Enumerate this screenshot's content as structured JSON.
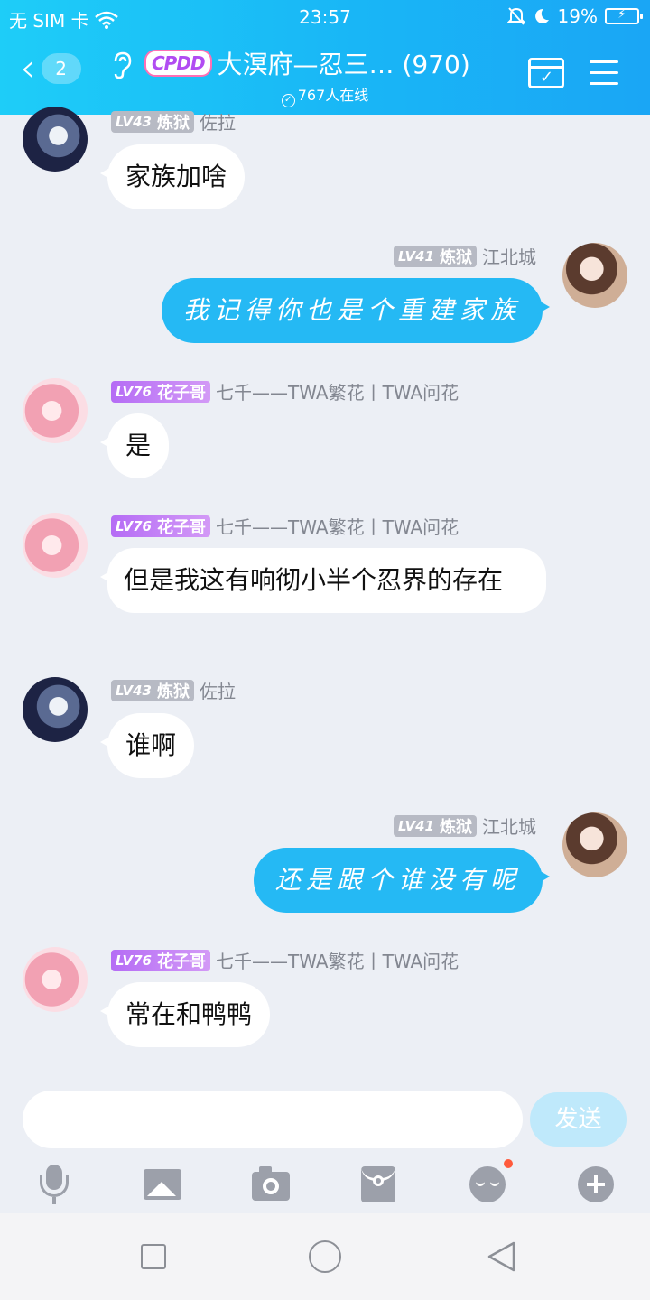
{
  "status_bar": {
    "carrier": "无 SIM 卡",
    "time": "23:57",
    "battery": "19%"
  },
  "header": {
    "back_count": "2",
    "group_badge": "CPDD",
    "title": "大溟府—忍三… (970)",
    "online": "767人在线"
  },
  "messages": [
    {
      "dir": "in",
      "level": "LV43",
      "tag": "炼狱",
      "sender": "佐拉",
      "text": "家族加啥"
    },
    {
      "dir": "out",
      "level": "LV41",
      "tag": "炼狱",
      "sender": "江北城",
      "text": "我记得你也是个重建家族"
    },
    {
      "dir": "in",
      "level": "LV76",
      "tag": "花子哥",
      "sender": "七千——TWA繁花丨TWA问花",
      "text": "是"
    },
    {
      "dir": "in",
      "level": "LV76",
      "tag": "花子哥",
      "sender": "七千——TWA繁花丨TWA问花",
      "text": "但是我这有响彻小半个忍界的存在"
    },
    {
      "dir": "in",
      "level": "LV43",
      "tag": "炼狱",
      "sender": "佐拉",
      "text": "谁啊"
    },
    {
      "dir": "out",
      "level": "LV41",
      "tag": "炼狱",
      "sender": "江北城",
      "text": "还是跟个谁没有呢"
    },
    {
      "dir": "in",
      "level": "LV76",
      "tag": "花子哥",
      "sender": "七千——TWA繁花丨TWA问花",
      "text": "常在和鸭鸭"
    }
  ],
  "input": {
    "value": "",
    "send_label": "发送"
  },
  "toolbar_icons": [
    "mic-icon",
    "image-icon",
    "camera-icon",
    "red-packet-icon",
    "emoji-icon",
    "plus-icon"
  ],
  "colors": {
    "header_start": "#1ecdf8",
    "header_end": "#1aa6f5",
    "outgoing_bubble": "#25b9f4",
    "chat_background": "#eceff5",
    "badge_purple": "#b56cf5",
    "badge_grey": "#b7bac4",
    "notification_dot": "#ff5a3c"
  }
}
